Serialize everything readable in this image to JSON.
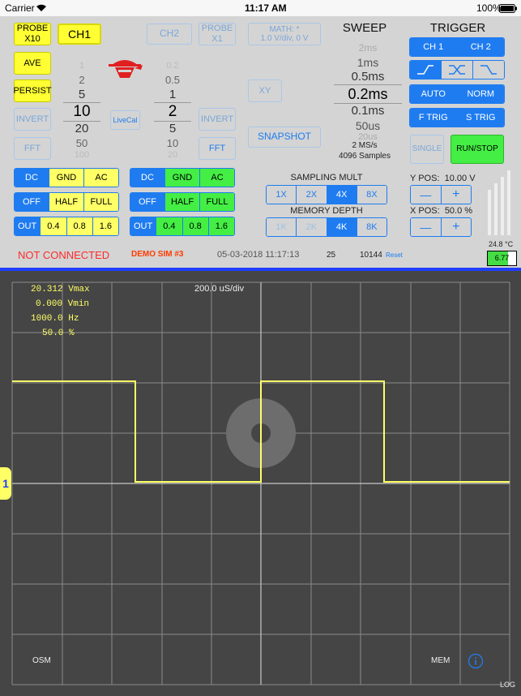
{
  "status": {
    "carrier": "Carrier",
    "time": "11:17 AM",
    "battery": "100%"
  },
  "channel": {
    "probe1": "PROBE\nX10",
    "ch1": "CH1",
    "ave": "AVE",
    "persist": "PERSIST",
    "invert1": "INVERT",
    "fft1": "FFT",
    "livecal": "LiveCal",
    "ch2": "CH2",
    "probe2": "PROBE\nX1",
    "invert2": "INVERT",
    "fft2": "FFT",
    "math": "MATH: *\n1.0 V/div, 0 V",
    "xy": "XY",
    "snapshot": "SNAPSHOT"
  },
  "wheel1": [
    "1",
    "2",
    "5",
    "10",
    "20",
    "50",
    "100"
  ],
  "wheel2": [
    "0.2",
    "0.5",
    "1",
    "2",
    "5",
    "10",
    "20"
  ],
  "sweep": {
    "title": "SWEEP",
    "values": [
      "2ms",
      "1ms",
      "0.5ms",
      "0.2ms",
      "0.1ms",
      "50us",
      "20us"
    ],
    "rate": "2 MS/s",
    "samples": "4096 Samples"
  },
  "trigger": {
    "title": "TRIGGER",
    "ch1": "CH 1",
    "ch2": "CH 2",
    "auto": "AUTO",
    "norm": "NORM",
    "ftrig": "F TRIG",
    "strig": "S TRIG",
    "single": "SINGLE",
    "runstop": "RUN/STOP"
  },
  "coupling1": [
    "DC",
    "GND",
    "AC"
  ],
  "coupling2": [
    "DC",
    "GND",
    "AC"
  ],
  "gain1": [
    "OFF",
    "HALF",
    "FULL"
  ],
  "gain2": [
    "OFF",
    "HALF",
    "FULL"
  ],
  "out1": [
    "OUT",
    "0.4",
    "0.8",
    "1.6"
  ],
  "out2": [
    "OUT",
    "0.4",
    "0.8",
    "1.6"
  ],
  "sampling": {
    "title": "SAMPLING MULT",
    "options": [
      "1X",
      "2X",
      "4X",
      "8X"
    ]
  },
  "memory": {
    "title": "MEMORY DEPTH",
    "options": [
      "1K",
      "2K",
      "4K",
      "8K"
    ]
  },
  "ypos": {
    "label": "Y POS:",
    "value": "10.00 V",
    "minus": "—",
    "plus": "+"
  },
  "xpos": {
    "label": "X POS:",
    "value": "50.0 %",
    "minus": "—",
    "plus": "+"
  },
  "temp": "24.8 °C",
  "battery_val": "6.77",
  "footer": {
    "connection": "NOT CONNECTED",
    "demo": "DEMO SIM #3",
    "datetime": "05-03-2018 11:17:13",
    "count1": "25",
    "count2": "10144",
    "reset": "Reset"
  },
  "scope": {
    "timediv": "200.0 uS/div",
    "vmax_val": "20.312",
    "vmax_lbl": "Vmax",
    "vmin_val": "0.000",
    "vmin_lbl": "Vmin",
    "freq_val": "1000.0",
    "freq_lbl": "Hz",
    "duty_val": "50.0",
    "duty_lbl": "%",
    "osm": "OSM",
    "mem": "MEM",
    "log": "LOG",
    "marker": "1"
  },
  "colors": {
    "accent": "#1f7cf0",
    "trace": "#ffff66",
    "alert": "#ff2a2a",
    "demo": "#ff3b00"
  }
}
